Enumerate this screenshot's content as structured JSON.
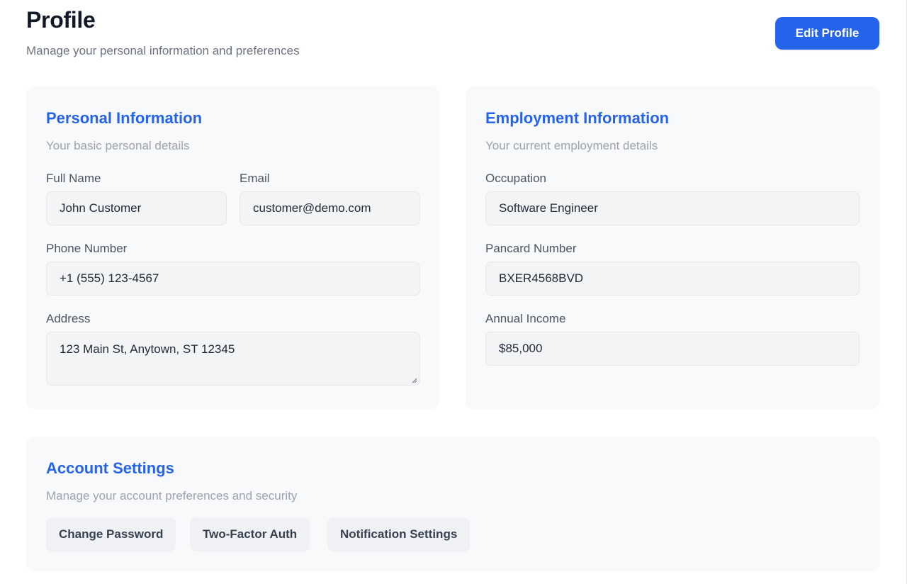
{
  "header": {
    "title": "Profile",
    "subtitle": "Manage your personal information and preferences",
    "edit_button": "Edit Profile"
  },
  "personal": {
    "title": "Personal Information",
    "description": "Your basic personal details",
    "full_name": {
      "label": "Full Name",
      "value": "John Customer"
    },
    "email": {
      "label": "Email",
      "value": "customer@demo.com"
    },
    "phone": {
      "label": "Phone Number",
      "value": "+1 (555) 123-4567"
    },
    "address": {
      "label": "Address",
      "value": "123 Main St, Anytown, ST 12345"
    }
  },
  "employment": {
    "title": "Employment Information",
    "description": "Your current employment details",
    "occupation": {
      "label": "Occupation",
      "value": "Software Engineer"
    },
    "pancard": {
      "label": "Pancard Number",
      "value": "BXER4568BVD"
    },
    "income": {
      "label": "Annual Income",
      "value": "$85,000"
    }
  },
  "account": {
    "title": "Account Settings",
    "description": "Manage your account preferences and security",
    "buttons": [
      "Change Password",
      "Two-Factor Auth",
      "Notification Settings"
    ]
  },
  "colors": {
    "accent": "#2563eb",
    "card_bg": "#f8f9fb",
    "input_bg": "#f3f4f6"
  }
}
